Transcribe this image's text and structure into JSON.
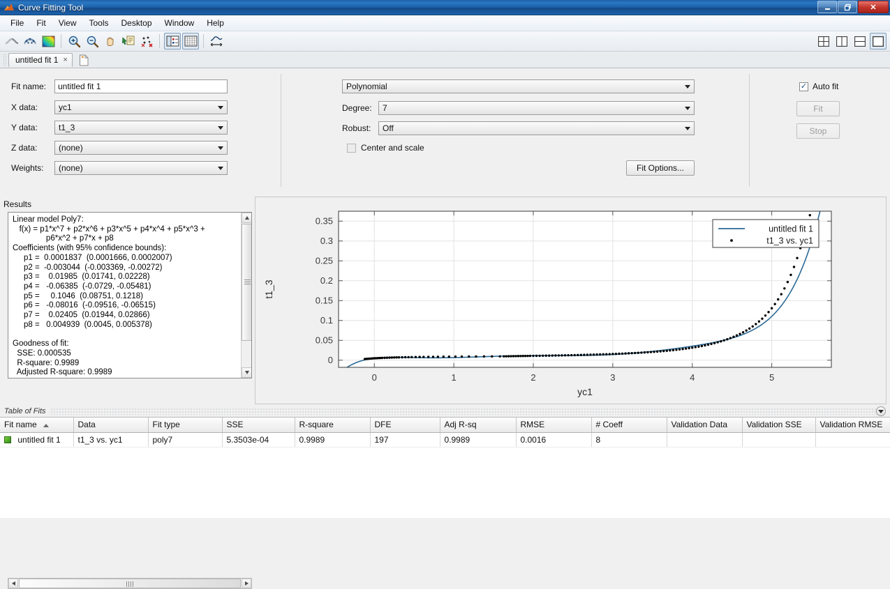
{
  "window": {
    "title": "Curve Fitting Tool",
    "app_icon": "matlab-curvefit-icon",
    "minimize_label": "–",
    "restore_label": "❐",
    "close_label": "✕"
  },
  "menubar": {
    "items": [
      {
        "label": "File",
        "name": "menu-file"
      },
      {
        "label": "Fit",
        "name": "menu-fit"
      },
      {
        "label": "View",
        "name": "menu-view"
      },
      {
        "label": "Tools",
        "name": "menu-tools"
      },
      {
        "label": "Desktop",
        "name": "menu-desktop"
      },
      {
        "label": "Window",
        "name": "menu-window"
      },
      {
        "label": "Help",
        "name": "menu-help"
      }
    ]
  },
  "toolbar": {
    "left_buttons": [
      {
        "icon": "fit-curve-icon",
        "title": "Fit curve"
      },
      {
        "icon": "fit-surface-icon",
        "title": "Fit surface"
      },
      {
        "icon": "colormap-surface-icon",
        "title": "Surface plot"
      }
    ],
    "zoom_buttons": [
      {
        "icon": "zoom-in-icon",
        "title": "Zoom In"
      },
      {
        "icon": "zoom-out-icon",
        "title": "Zoom Out"
      },
      {
        "icon": "pan-hand-icon",
        "title": "Pan"
      },
      {
        "icon": "data-cursor-icon",
        "title": "Data Cursor"
      },
      {
        "icon": "exclude-outliers-icon",
        "title": "Exclude outliers"
      }
    ],
    "view_buttons": [
      {
        "icon": "legend-icon",
        "title": "Legend",
        "selected": true
      },
      {
        "icon": "grid-icon",
        "title": "Grid",
        "selected": true
      }
    ],
    "axes_buttons": [
      {
        "icon": "axes-limits-icon",
        "title": "Axes limits"
      }
    ],
    "layout_buttons": [
      {
        "icon": "layout-four-pane-icon",
        "title": "Four panes",
        "selected": false
      },
      {
        "icon": "layout-two-column-icon",
        "title": "Two columns",
        "selected": false
      },
      {
        "icon": "layout-two-row-icon",
        "title": "Two rows",
        "selected": false
      },
      {
        "icon": "layout-single-pane-icon",
        "title": "Single pane",
        "selected": true
      }
    ],
    "close_doc_icon": "close-document-icon"
  },
  "tabs": {
    "items": [
      {
        "label": "untitled fit 1",
        "close_glyph": "×",
        "active": true
      }
    ],
    "new_tab_icon": "new-fit-icon"
  },
  "fit_config": {
    "fit_name": {
      "label": "Fit name:",
      "value": "untitled fit 1"
    },
    "x_data": {
      "label": "X data:",
      "value": "yc1"
    },
    "y_data": {
      "label": "Y data:",
      "value": "t1_3"
    },
    "z_data": {
      "label": "Z data:",
      "value": "(none)"
    },
    "weights": {
      "label": "Weights:",
      "value": "(none)"
    },
    "fit_type": {
      "value": "Polynomial"
    },
    "degree": {
      "label": "Degree:",
      "value": "7"
    },
    "robust": {
      "label": "Robust:",
      "value": "Off"
    },
    "center_and_scale": {
      "label": "Center and scale",
      "checked": false
    },
    "fit_options_button": "Fit Options...",
    "auto_fit": {
      "label": "Auto fit",
      "checked": true
    },
    "fit_button": {
      "label": "Fit",
      "disabled": true
    },
    "stop_button": {
      "label": "Stop",
      "disabled": true
    }
  },
  "results": {
    "caption": "Results",
    "text": "Linear model Poly7:\n   f(x) = p1*x^7 + p2*x^6 + p3*x^5 + p4*x^4 + p5*x^3 +\n               p6*x^2 + p7*x + p8\nCoefficients (with 95% confidence bounds):\n     p1 =  0.0001837  (0.0001666, 0.0002007)\n     p2 =  -0.003044  (-0.003369, -0.00272)\n     p3 =    0.01985  (0.01741, 0.02228)\n     p4 =   -0.06385  (-0.0729, -0.05481)\n     p5 =     0.1046  (0.08751, 0.1218)\n     p6 =   -0.08016  (-0.09516, -0.06515)\n     p7 =    0.02405  (0.01944, 0.02866)\n     p8 =   0.004939  (0.0045, 0.005378)\n\nGoodness of fit:\n  SSE: 0.000535\n  R-square: 0.9989\n  Adjusted R-square: 0.9989"
  },
  "chart_data": {
    "type": "scatter",
    "title": "",
    "xlabel": "yc1",
    "ylabel": "t1_3",
    "xlim": [
      -0.45,
      5.75
    ],
    "ylim": [
      -0.018,
      0.375
    ],
    "xticks": [
      0,
      1,
      2,
      3,
      4,
      5
    ],
    "yticks": [
      0,
      0.05,
      0.1,
      0.15,
      0.2,
      0.25,
      0.3,
      0.35
    ],
    "xticklabels": [
      "0",
      "1",
      "2",
      "3",
      "4",
      "5"
    ],
    "yticklabels": [
      "0",
      "0.05",
      "0.1",
      "0.15",
      "0.2",
      "0.25",
      "0.3",
      "0.35"
    ],
    "grid": true,
    "legend_position": "northeast",
    "legend": [
      {
        "label": "untitled fit 1",
        "kind": "line",
        "color": "#2a6a96"
      },
      {
        "label": "t1_3 vs. yc1",
        "kind": "marker",
        "color": "#000000"
      }
    ],
    "series": [
      {
        "name": "untitled fit 1",
        "kind": "line",
        "color": "#2a6a96",
        "model": "poly7",
        "coefficients": [
          0.0001837,
          -0.003044,
          0.01985,
          -0.06385,
          0.1046,
          -0.08016,
          0.02405,
          0.004939
        ],
        "x_start": -0.42,
        "x_end": 5.66
      },
      {
        "name": "t1_3 vs. yc1",
        "kind": "scatter",
        "color": "#000000",
        "n_points": 205,
        "x": [
          -0.12,
          -0.1,
          -0.08,
          -0.06,
          -0.04,
          -0.02,
          0.0,
          0.02,
          0.04,
          0.06,
          0.08,
          0.1,
          0.13,
          0.16,
          0.19,
          0.22,
          0.25,
          0.28,
          0.31,
          0.35,
          0.39,
          0.43,
          0.47,
          0.52,
          0.57,
          0.62,
          0.68,
          0.74,
          0.8,
          0.87,
          0.94,
          1.02,
          1.1,
          1.19,
          1.28,
          1.38,
          1.48,
          1.58,
          1.63,
          1.66,
          1.69,
          1.72,
          1.75,
          1.78,
          1.81,
          1.84,
          1.87,
          1.9,
          1.93,
          1.96,
          2.0,
          2.04,
          2.08,
          2.12,
          2.16,
          2.2,
          2.24,
          2.28,
          2.32,
          2.36,
          2.4,
          2.44,
          2.48,
          2.52,
          2.56,
          2.6,
          2.64,
          2.68,
          2.72,
          2.76,
          2.8,
          2.84,
          2.88,
          2.92,
          2.96,
          3.0,
          3.04,
          3.08,
          3.12,
          3.16,
          3.2,
          3.24,
          3.28,
          3.32,
          3.36,
          3.4,
          3.44,
          3.48,
          3.52,
          3.56,
          3.6,
          3.64,
          3.68,
          3.72,
          3.76,
          3.8,
          3.84,
          3.88,
          3.92,
          3.96,
          4.0,
          4.04,
          4.08,
          4.12,
          4.16,
          4.2,
          4.24,
          4.28,
          4.32,
          4.36,
          4.4,
          4.44,
          4.48,
          4.52,
          4.56,
          4.6,
          4.64,
          4.68,
          4.72,
          4.76,
          4.8,
          4.84,
          4.88,
          4.92,
          4.96,
          5.0,
          5.04,
          5.08,
          5.12,
          5.16,
          5.2,
          5.24,
          5.28,
          5.32,
          5.36,
          5.4,
          5.44,
          5.48,
          5.52,
          5.56,
          5.6,
          5.64
        ],
        "y": [
          0.003,
          0.0033,
          0.0036,
          0.0039,
          0.0042,
          0.0045,
          0.0048,
          0.005,
          0.0052,
          0.0054,
          0.0056,
          0.0058,
          0.006,
          0.0062,
          0.0064,
          0.0066,
          0.0068,
          0.007,
          0.0071,
          0.0073,
          0.0075,
          0.0076,
          0.0078,
          0.0079,
          0.0081,
          0.0082,
          0.0084,
          0.0085,
          0.0086,
          0.0088,
          0.0089,
          0.009,
          0.0091,
          0.0092,
          0.0093,
          0.0094,
          0.0095,
          0.0096,
          0.0097,
          0.0098,
          0.0099,
          0.01,
          0.0101,
          0.0102,
          0.0103,
          0.0104,
          0.0105,
          0.0106,
          0.0107,
          0.0108,
          0.0109,
          0.011,
          0.0111,
          0.0113,
          0.0114,
          0.0115,
          0.0117,
          0.0118,
          0.012,
          0.0121,
          0.0123,
          0.0124,
          0.0126,
          0.0128,
          0.013,
          0.0132,
          0.0134,
          0.0136,
          0.0138,
          0.014,
          0.0143,
          0.0145,
          0.0148,
          0.015,
          0.0153,
          0.0156,
          0.0159,
          0.0162,
          0.0166,
          0.0169,
          0.0173,
          0.0177,
          0.0181,
          0.0185,
          0.019,
          0.0195,
          0.02,
          0.0205,
          0.0211,
          0.0217,
          0.0223,
          0.023,
          0.0237,
          0.0245,
          0.0253,
          0.0262,
          0.0271,
          0.0281,
          0.0292,
          0.0303,
          0.0315,
          0.0328,
          0.0342,
          0.0357,
          0.0373,
          0.039,
          0.0409,
          0.0429,
          0.0451,
          0.0474,
          0.0499,
          0.0526,
          0.0556,
          0.0588,
          0.0623,
          0.0661,
          0.0702,
          0.0747,
          0.0796,
          0.085,
          0.0909,
          0.0974,
          0.1045,
          0.1124,
          0.1211,
          0.1307,
          0.1413,
          0.1531,
          0.1661,
          0.1806,
          0.1967,
          0.2147,
          0.2347,
          0.2571,
          0.2821,
          0.3101,
          0.3415,
          0.365
        ]
      }
    ]
  },
  "table_of_fits": {
    "caption": "Table of Fits",
    "collapse_icon": "chevron-down-icon",
    "columns": [
      "Fit name",
      "Data",
      "Fit type",
      "SSE",
      "R-square",
      "DFE",
      "Adj R-sq",
      "RMSE",
      "# Coeff",
      "Validation Data",
      "Validation SSE",
      "Validation RMSE"
    ],
    "sorted_column": "Fit name",
    "rows": [
      {
        "Fit name": "untitled fit 1",
        "Data": "t1_3 vs. yc1",
        "Fit type": "poly7",
        "SSE": "5.3503e-04",
        "R-square": "0.9989",
        "DFE": "197",
        "Adj R-sq": "0.9989",
        "RMSE": "0.0016",
        "# Coeff": "8",
        "Validation Data": "",
        "Validation SSE": "",
        "Validation RMSE": ""
      }
    ]
  }
}
